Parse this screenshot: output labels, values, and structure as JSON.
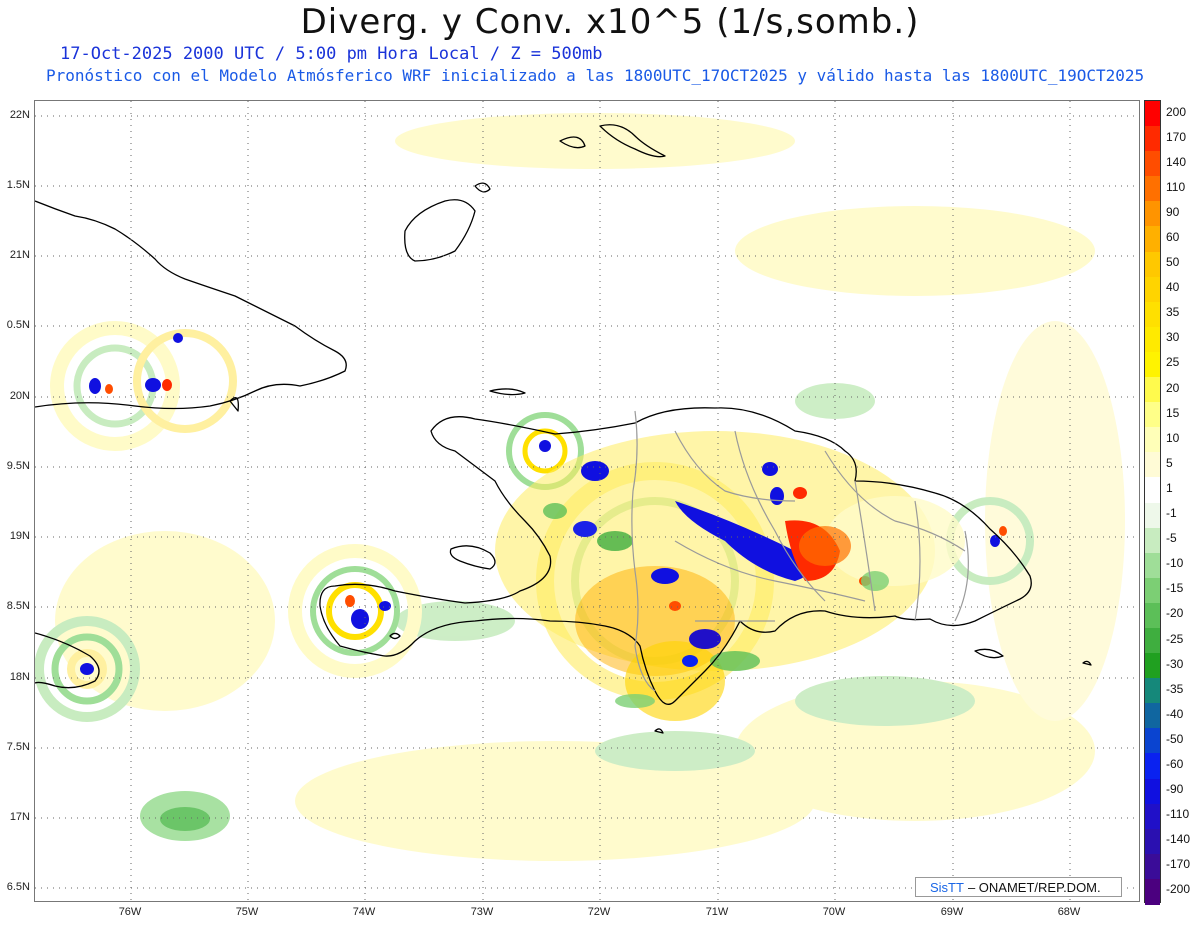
{
  "title": "Diverg. y Conv. x10^5 (1/s,somb.)",
  "subtitle_line1": "17-Oct-2025  2000 UTC / 5:00 pm Hora Local / Z = 500mb",
  "subtitle_line2": "Pronóstico con el Modelo Atmósferico WRF inicializado a las 1800UTC_17OCT2025 y válido hasta las  1800UTC_19OCT2025",
  "latitude_labels": [
    "22N",
    "1.5N",
    "21N",
    "0.5N",
    "20N",
    "9.5N",
    "19N",
    "8.5N",
    "18N",
    "7.5N",
    "17N",
    "6.5N"
  ],
  "longitude_labels": [
    "76W",
    "75W",
    "74W",
    "73W",
    "72W",
    "71W",
    "70W",
    "69W",
    "68W"
  ],
  "credit": {
    "brand": "SisTT",
    "text": "– ONAMET/REP.DOM."
  },
  "colorbar": {
    "labels": [
      "200",
      "170",
      "140",
      "110",
      "90",
      "60",
      "50",
      "40",
      "35",
      "30",
      "25",
      "20",
      "15",
      "10",
      "5",
      "1",
      "-1",
      "-5",
      "-10",
      "-15",
      "-20",
      "-25",
      "-30",
      "-35",
      "-40",
      "-50",
      "-60",
      "-90",
      "-110",
      "-140",
      "-170",
      "-200"
    ],
    "colors": [
      "#ff0000",
      "#ff2a00",
      "#ff4d00",
      "#ff7000",
      "#ff9400",
      "#ffb000",
      "#ffc800",
      "#ffd400",
      "#ffe000",
      "#ffea00",
      "#fff300",
      "#fffa4d",
      "#ffff88",
      "#ffffb8",
      "#fffbd6",
      "#ffffff",
      "#eef8ea",
      "#c8ecc0",
      "#9fde98",
      "#7ccf74",
      "#5cbf58",
      "#3fae3f",
      "#20a020",
      "#15887a",
      "#1066a0",
      "#0a44d0",
      "#0a22f0",
      "#1010e0",
      "#2010c8",
      "#2a10b0",
      "#3a0c98",
      "#4b007f"
    ]
  }
}
